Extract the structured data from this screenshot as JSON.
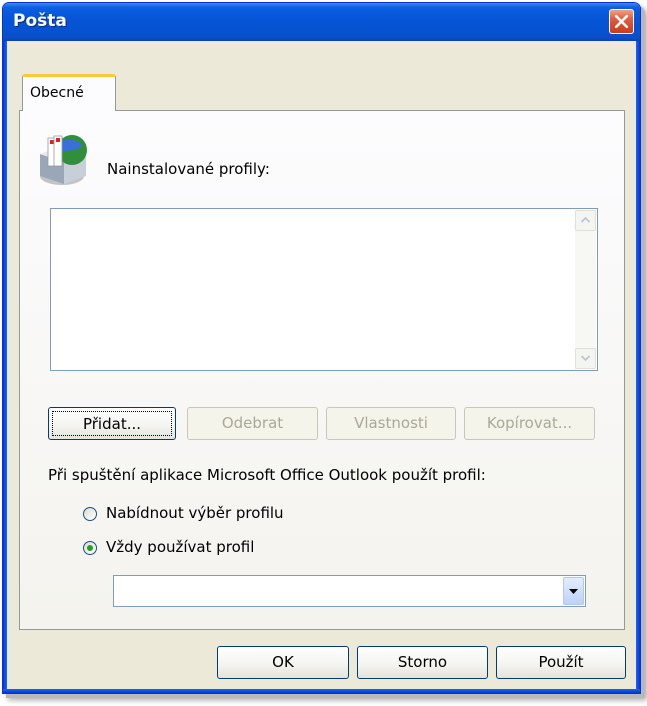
{
  "window": {
    "title": "Pošta"
  },
  "tabs": [
    {
      "label": "Obecné"
    }
  ],
  "profiles": {
    "label": "Nainstalované profily:",
    "items": []
  },
  "buttons": {
    "add": "Přidat...",
    "remove": "Odebrat",
    "properties": "Vlastnosti",
    "copy": "Kopírovat..."
  },
  "startup": {
    "label": "Při spuštění aplikace Microsoft Office Outlook použít profil:",
    "options": [
      {
        "label": "Nabídnout výběr profilu",
        "selected": false
      },
      {
        "label": "Vždy používat profil",
        "selected": true
      }
    ],
    "selected_profile": ""
  },
  "footer": {
    "ok": "OK",
    "cancel": "Storno",
    "apply": "Použít"
  },
  "colors": {
    "titlebar": "#0655d8",
    "dialog_bg": "#ece9d8",
    "tab_highlight": "#ffc83c",
    "close_button": "#e25a3c"
  },
  "icons": [
    "close-icon",
    "mail-profiles-icon",
    "scroll-up-arrow-icon",
    "scroll-down-arrow-icon",
    "dropdown-arrow-icon"
  ]
}
